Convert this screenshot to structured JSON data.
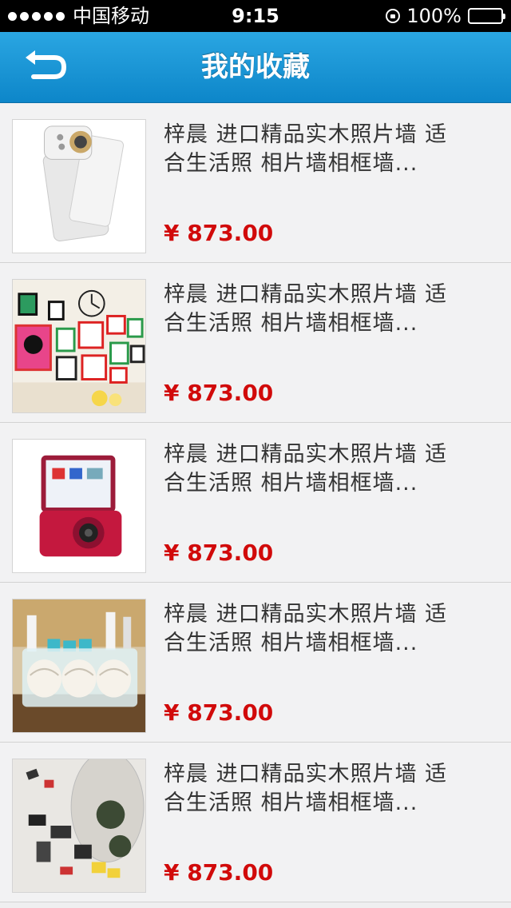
{
  "status_bar": {
    "carrier": "中国移动",
    "time": "9:15",
    "battery": "100%"
  },
  "nav": {
    "title": "我的收藏",
    "back_icon": "back-arrow-icon"
  },
  "items": [
    {
      "name_line1": "梓晨 进口精品实木照片墙 适",
      "name_line2": "合生活照 相片墙相框墙...",
      "price": "¥ 873.00",
      "image": "white-camera"
    },
    {
      "name_line1": "梓晨 进口精品实木照片墙 适",
      "name_line2": "合生活照 相片墙相框墙...",
      "price": "¥ 873.00",
      "image": "photo-frame-wall"
    },
    {
      "name_line1": "梓晨 进口精品实木照片墙 适",
      "name_line2": "合生活照 相片墙相框墙...",
      "price": "¥ 873.00",
      "image": "red-camera"
    },
    {
      "name_line1": "梓晨 进口精品实木照片墙 适",
      "name_line2": "合生活照 相片墙相框墙...",
      "price": "¥ 873.00",
      "image": "rolled-towels"
    },
    {
      "name_line1": "梓晨 进口精品实木照片墙 适",
      "name_line2": "合生活照 相片墙相框墙...",
      "price": "¥ 873.00",
      "image": "desk-items"
    }
  ],
  "colors": {
    "nav_bg": "#1c97d6",
    "price": "#d10a0a",
    "text": "#333333"
  }
}
